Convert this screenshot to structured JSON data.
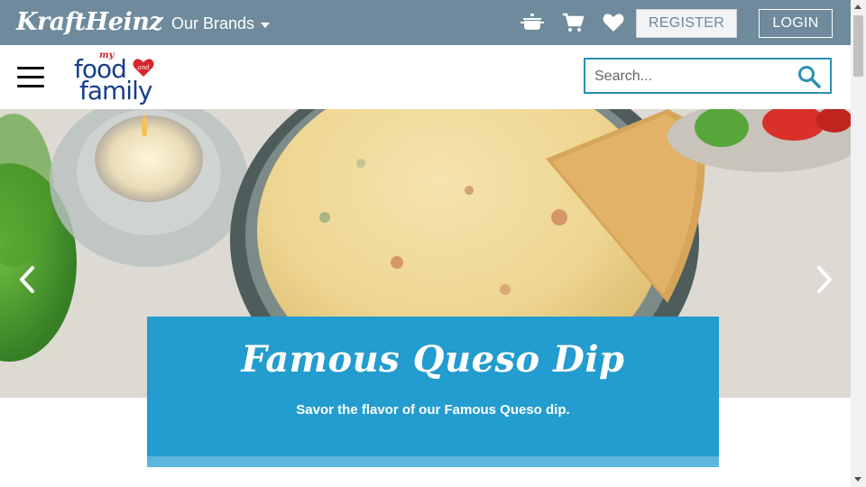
{
  "topbar": {
    "brand_logo": "KraftHeinz",
    "brands_label": "Our Brands",
    "icons": [
      "pot-icon",
      "cart-icon",
      "heart-icon"
    ],
    "register_label": "REGISTER",
    "login_label": "LOGIN",
    "bg_color": "#6e8a9c"
  },
  "nav": {
    "logo": {
      "my": "my",
      "food": "food",
      "and": "and",
      "family": "family"
    },
    "search": {
      "placeholder": "Search...",
      "value": ""
    },
    "accent_color": "#2a8fb5"
  },
  "hero": {
    "title": "Famous Queso Dip",
    "subtitle": "Savor the flavor of our Famous Queso dip.",
    "caption_color": "#239ccf",
    "prev_icon": "chevron-left-icon",
    "next_icon": "chevron-right-icon"
  }
}
